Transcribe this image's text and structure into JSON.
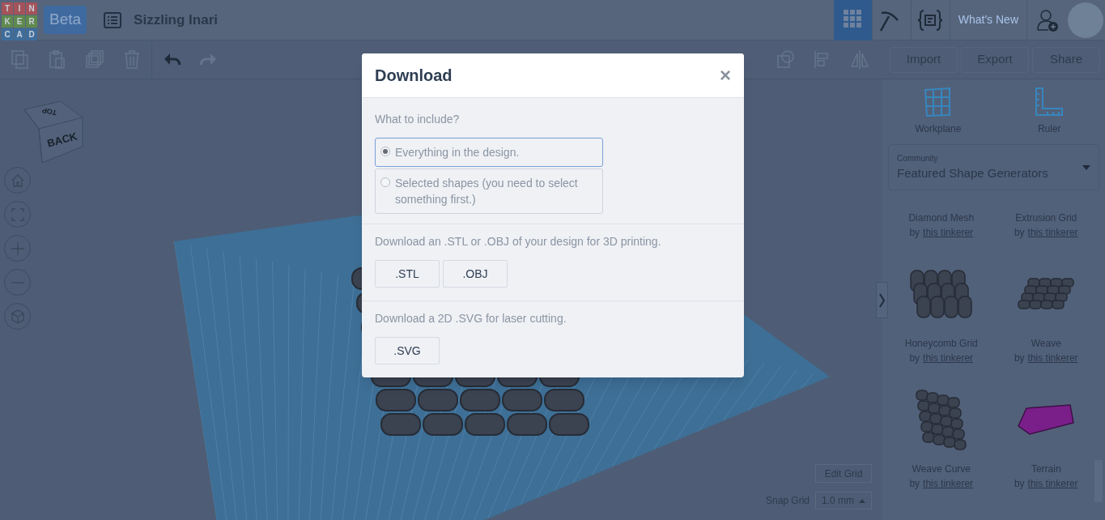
{
  "header": {
    "logo_letters": [
      "T",
      "I",
      "N",
      "K",
      "E",
      "R",
      "C",
      "A",
      "D"
    ],
    "badge": "Beta",
    "title": "Sizzling Inari",
    "nav": [
      {
        "kind": "grid",
        "selected": true
      },
      {
        "kind": "pickaxe",
        "selected": false
      },
      {
        "kind": "code",
        "selected": false
      }
    ],
    "whats_new": "What's New"
  },
  "toolbar": {
    "tools": [
      {
        "kind": "copy",
        "disabled": true
      },
      {
        "kind": "paste",
        "disabled": true
      },
      {
        "kind": "duplicate",
        "disabled": true
      },
      {
        "kind": "delete",
        "disabled": true
      },
      {
        "kind": "undo",
        "disabled": false
      },
      {
        "kind": "redo",
        "disabled": true
      }
    ],
    "tools_right": [
      {
        "kind": "shape",
        "disabled": true
      },
      {
        "kind": "align",
        "disabled": true
      },
      {
        "kind": "mirror",
        "disabled": true
      }
    ],
    "buttons": [
      "Import",
      "Export",
      "Share"
    ]
  },
  "view_cube": {
    "top": "TOP",
    "back": "BACK"
  },
  "view_controls": [
    {
      "kind": "home"
    },
    {
      "kind": "fit"
    },
    {
      "kind": "zoom_in"
    },
    {
      "kind": "zoom_out"
    },
    {
      "kind": "perspective"
    }
  ],
  "panel": {
    "tools": [
      {
        "kind": "workplane",
        "label": "Workplane"
      },
      {
        "kind": "ruler",
        "label": "Ruler"
      }
    ],
    "library": {
      "label": "Community",
      "value": "Featured Shape Generators"
    },
    "shapes": [
      {
        "name": "Diamond Mesh",
        "by": "by",
        "author": "this tinkerer",
        "kind": "hidden"
      },
      {
        "name": "Extrusion Grid",
        "by": "by",
        "author": "this tinkerer",
        "kind": "hidden"
      },
      {
        "name": "Honeycomb Grid",
        "by": "by",
        "author": "this tinkerer",
        "kind": "honeycomb"
      },
      {
        "name": "Weave",
        "by": "by",
        "author": "this tinkerer",
        "kind": "weave"
      },
      {
        "name": "Weave Curve",
        "by": "by",
        "author": "this tinkerer",
        "kind": "curve"
      },
      {
        "name": "Terrain",
        "by": "by",
        "author": "this tinkerer",
        "kind": "terrain"
      }
    ]
  },
  "grid_controls": {
    "edit": "Edit Grid",
    "snap_label": "Snap Grid",
    "snap_value": "1.0 mm"
  },
  "dialog": {
    "title": "Download",
    "close": "×",
    "question": "What to include?",
    "options": [
      {
        "label": "Everything in the design.",
        "selected": true
      },
      {
        "label": "Selected shapes (you need to select something first.)",
        "selected": false
      }
    ],
    "sections": [
      {
        "text": "Download an .STL or .OBJ of your design for 3D printing.",
        "buttons": [
          ".STL",
          ".OBJ"
        ]
      },
      {
        "text": "Download a 2D .SVG for laser cutting.",
        "buttons": [
          ".SVG"
        ]
      }
    ]
  }
}
